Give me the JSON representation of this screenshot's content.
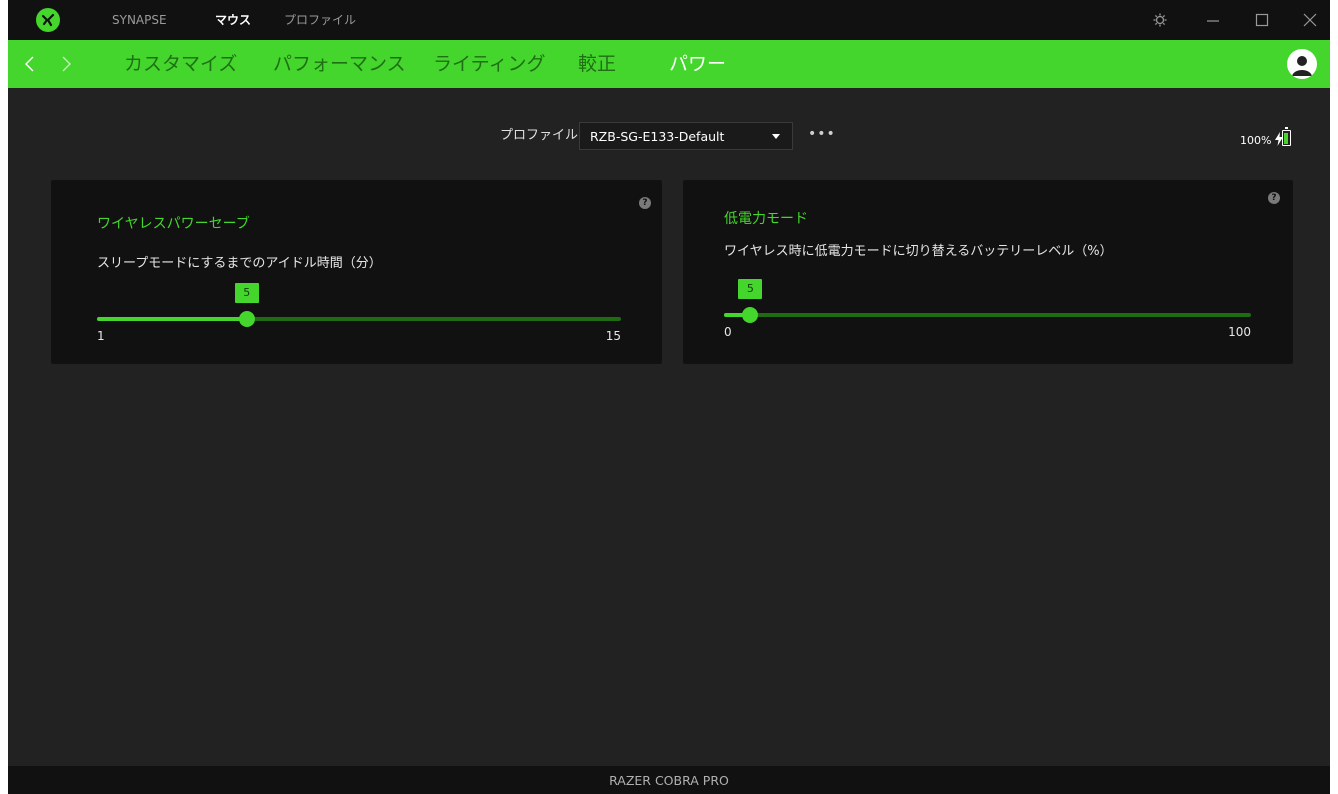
{
  "app": {
    "brand_color": "#44d62c"
  },
  "titlebar": {
    "nav": [
      {
        "label": "SYNAPSE"
      },
      {
        "label": "マウス"
      },
      {
        "label": "プロファイル"
      }
    ],
    "active_nav": "マウス"
  },
  "menubar": {
    "tabs": [
      {
        "label": "カスタマイズ"
      },
      {
        "label": "パフォーマンス"
      },
      {
        "label": "ライティング"
      },
      {
        "label": "較正"
      },
      {
        "label": "パワー"
      }
    ],
    "active_tab": "パワー"
  },
  "profile": {
    "label": "プロファイル",
    "selected": "RZB-SG-E133-Default",
    "more": "•••"
  },
  "battery": {
    "percent_text": "100%",
    "level": 1.0
  },
  "cards": {
    "power_save": {
      "title": "ワイヤレスパワーセーブ",
      "description": "スリープモードにするまでのアイドル時間（分）",
      "value": 5,
      "value_label": "5",
      "min": 1,
      "max": 15,
      "min_label": "1",
      "max_label": "15",
      "help": "?"
    },
    "low_power": {
      "title": "低電力モード",
      "description": "ワイヤレス時に低電力モードに切り替えるバッテリーレベル（%）",
      "value": 5,
      "value_label": "5",
      "min": 0,
      "max": 100,
      "min_label": "0",
      "max_label": "100",
      "help": "?"
    }
  },
  "footer": {
    "device_name": "RAZER COBRA PRO"
  },
  "icons": [
    "razer-logo-icon",
    "settings-icon",
    "minimize-icon",
    "maximize-icon",
    "close-icon",
    "back-arrow-icon",
    "forward-arrow-icon",
    "user-avatar-icon",
    "dropdown-caret-icon",
    "more-icon",
    "charging-bolt-icon",
    "battery-icon",
    "help-icon"
  ]
}
